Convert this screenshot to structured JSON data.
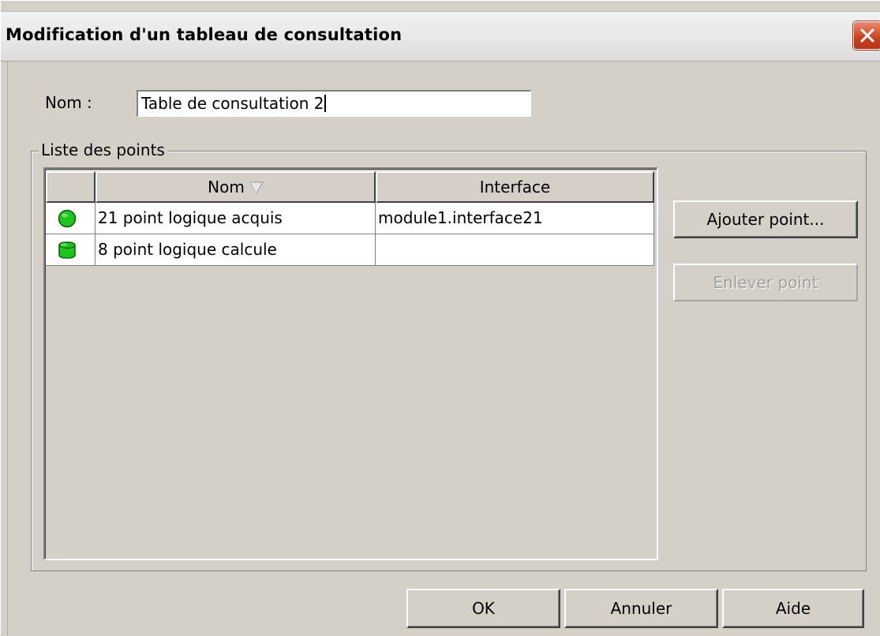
{
  "window": {
    "title": "Modification d'un tableau de consultation"
  },
  "form": {
    "name_label": "Nom :",
    "name_value": "Table de consultation 2"
  },
  "points_group": {
    "legend": "Liste des points",
    "columns": [
      "",
      "Nom",
      "Interface"
    ],
    "sort_icon": "sort-descending-triangle-icon",
    "rows": [
      {
        "icon": "status-dot-green-circle-icon",
        "nom": "21 point logique acquis",
        "interface": "module1.interface21"
      },
      {
        "icon": "status-dot-green-cylinder-icon",
        "nom": "8 point logique calcule",
        "interface": ""
      }
    ]
  },
  "side_buttons": {
    "add": "Ajouter point...",
    "remove": "Enlever point"
  },
  "footer_buttons": {
    "ok": "OK",
    "cancel": "Annuler",
    "help": "Aide"
  },
  "colors": {
    "dialog_bg": "#d4d0c8",
    "status_green": "#1fc41f",
    "close_red": "#c8401f",
    "disabled_text": "#a0a0a0"
  }
}
